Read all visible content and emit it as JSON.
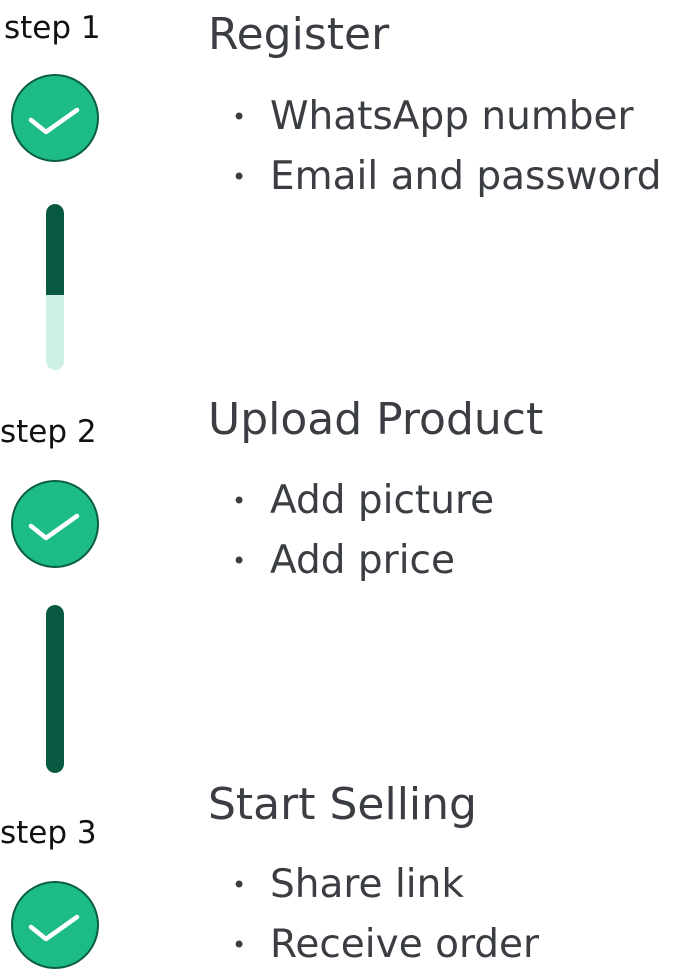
{
  "steps": [
    {
      "label": "step 1",
      "title": "Register",
      "items": [
        "WhatsApp number",
        "Email and password"
      ]
    },
    {
      "label": "step 2",
      "title": "Upload Product",
      "items": [
        "Add picture",
        "Add price"
      ]
    },
    {
      "label": "step 3",
      "title": "Start Selling",
      "items": [
        "Share link",
        "Receive order"
      ]
    }
  ],
  "connectors": [
    {
      "progress": 0.55
    },
    {
      "progress": 1.0
    }
  ],
  "icons": {
    "status": "check-circle-icon",
    "bullet": "bullet-dot-icon"
  },
  "colors": {
    "check_fill": "#1dbb85",
    "check_border": "#0b5e42",
    "connector_done": "#075a41",
    "connector_pending": "#cdf1e4",
    "text": "#3a3d42"
  }
}
